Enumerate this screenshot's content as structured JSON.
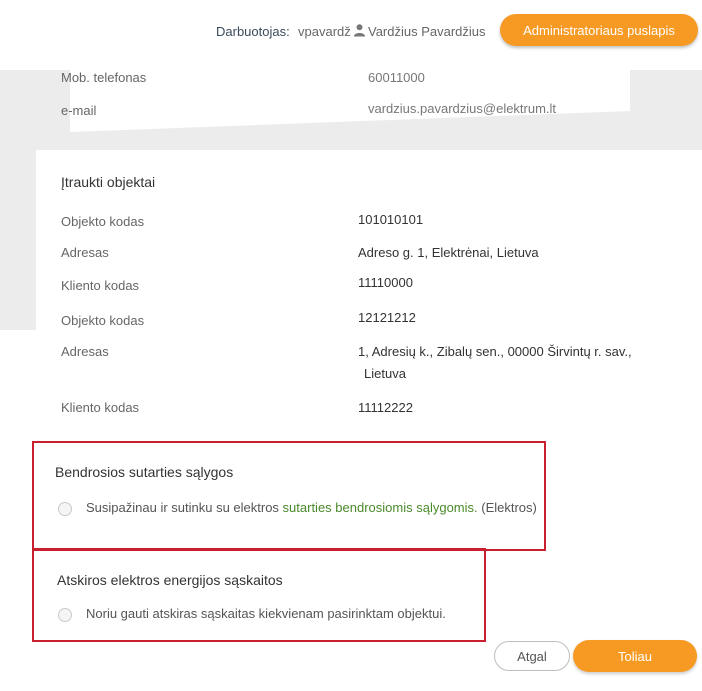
{
  "header": {
    "employee_label": "Darbuotojas:",
    "employee_username": "vpavardž",
    "user_name": "Vardžius Pavardžius",
    "admin_button": "Administratoriaus puslapis"
  },
  "contact": {
    "phone_label": "Mob. telefonas",
    "phone_value": "60011000",
    "email_label": "e-mail",
    "email_value": "vardzius.pavardzius@elektrum.lt"
  },
  "objects": {
    "title": "Įtraukti objektai",
    "rows": [
      {
        "label": "Objekto kodas",
        "value": "101010101"
      },
      {
        "label": "Adresas",
        "value": "Adreso g. 1, Elektrėnai, Lietuva"
      },
      {
        "label": "Kliento kodas",
        "value": "11110000"
      },
      {
        "label": "Objekto kodas",
        "value": "12121212"
      },
      {
        "label": "Adresas",
        "value": "1, Adresių  k., Zibalų sen., 00000 Širvintų r. sav.,",
        "value2": "Lietuva"
      },
      {
        "label": "Kliento kodas",
        "value": "11112222"
      }
    ]
  },
  "terms": {
    "title": "Bendrosios sutarties sąlygos",
    "text_before": "Susipažinau ir sutinku su elektros ",
    "link": "sutarties bendrosiomis sąlygomis.",
    "text_after": " (Elektros)"
  },
  "invoices": {
    "title": "Atskiros elektros energijos sąskaitos",
    "text": "Noriu gauti atskiras sąskaitas kiekvienam pasirinktam objektui."
  },
  "actions": {
    "back": "Atgal",
    "next": "Toliau"
  },
  "colors": {
    "accent": "#f79a24",
    "highlight_border": "#c8202e",
    "link": "#4a8a2a"
  }
}
